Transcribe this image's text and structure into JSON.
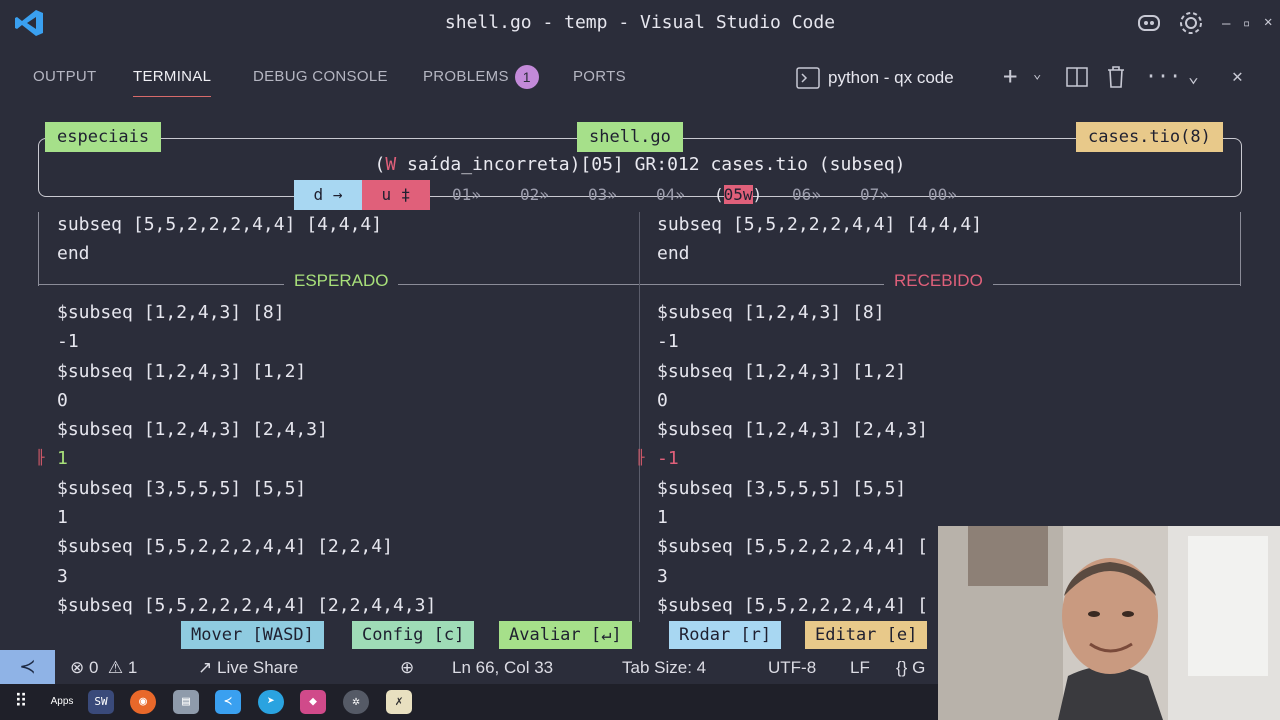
{
  "window": {
    "title": "shell.go - temp - Visual Studio Code"
  },
  "panel": {
    "tabs": [
      {
        "label": "OUTPUT"
      },
      {
        "label": "TERMINAL"
      },
      {
        "label": "DEBUG CONSOLE"
      },
      {
        "label": "PROBLEMS"
      },
      {
        "label": "PORTS"
      }
    ],
    "problems_count": "1",
    "terminal_name": "python - qx code"
  },
  "tui": {
    "left_label": "especiais",
    "center_label": "shell.go",
    "right_label": "cases.tio(8)",
    "status_prefix": "(",
    "status_w": "W",
    "status_rest": " saída_incorreta)[05] GR:012 cases.tio (subseq)",
    "nav_d": "d →",
    "nav_u": "u ‡",
    "nav_items": [
      "01»",
      "02»",
      "03»",
      "04»"
    ],
    "nav_active_open": "(",
    "nav_active": "05w",
    "nav_active_close": ")",
    "nav_after": [
      "06»",
      "07»",
      "00»"
    ],
    "expected_label": "ESPERADO",
    "received_label": "RECEBIDO",
    "left_top": [
      "subseq [5,5,2,2,2,4,4] [4,4,4]",
      "end"
    ],
    "right_top": [
      "subseq [5,5,2,2,2,4,4] [4,4,4]",
      "end"
    ],
    "expected_lines": [
      "$subseq [1,2,4,3] [8]",
      "-1",
      "$subseq [1,2,4,3] [1,2]",
      "0",
      "$subseq [1,2,4,3] [2,4,3]",
      "1",
      "$subseq [3,5,5,5] [5,5]",
      "1",
      "$subseq [5,5,2,2,2,4,4] [2,2,4]",
      "3",
      "$subseq [5,5,2,2,2,4,4] [2,2,4,4,3]"
    ],
    "received_lines": [
      "$subseq [1,2,4,3] [8]",
      "-1",
      "$subseq [1,2,4,3] [1,2]",
      "0",
      "$subseq [1,2,4,3] [2,4,3]",
      "-1",
      "$subseq [3,5,5,5] [5,5]",
      "1",
      "$subseq [5,5,2,2,2,4,4] [",
      "3",
      "$subseq [5,5,2,2,2,4,4] ["
    ],
    "diff_line_index": 5,
    "actions": [
      {
        "label": "Mover [WASD]",
        "color": "#8fcbe0"
      },
      {
        "label": "Config [c]",
        "color": "#9fdcb7"
      },
      {
        "label": "Avaliar  [↵]",
        "color": "#a6e08a"
      },
      {
        "label": "Rodar [r]",
        "color": "#a8d7f2"
      },
      {
        "label": "Editar [e]",
        "color": "#e8c98a"
      }
    ]
  },
  "statusbar": {
    "errors": "0",
    "warnings": "1",
    "live_share": "Live Share",
    "position": "Ln 66, Col 33",
    "tab_size": "Tab Size: 4",
    "encoding": "UTF-8",
    "eol": "LF",
    "lang": "{} G"
  },
  "taskbar": {
    "apps_label": "Apps"
  },
  "colors": {
    "background": "#2b2d3a",
    "expected": "#a8e07a",
    "received": "#e0607a",
    "label_green": "#a6e08a",
    "label_orange": "#e8c98a"
  }
}
